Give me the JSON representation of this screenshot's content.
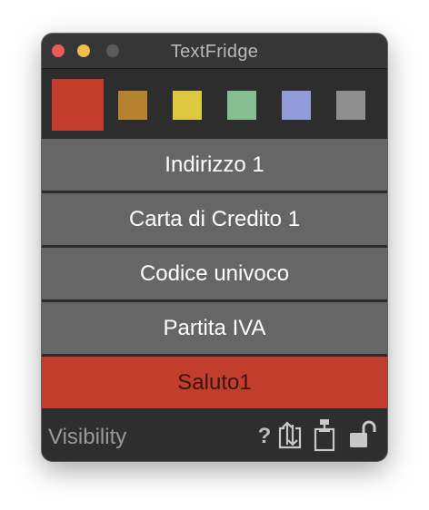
{
  "window": {
    "title": "TextFridge"
  },
  "palette": {
    "swatches": [
      {
        "name": "red",
        "color": "#c23d2b",
        "selected": true
      },
      {
        "name": "ochre",
        "color": "#b7822f",
        "selected": false
      },
      {
        "name": "yellow",
        "color": "#dcc940",
        "selected": false
      },
      {
        "name": "green",
        "color": "#88bd91",
        "selected": false
      },
      {
        "name": "lavender",
        "color": "#929ad8",
        "selected": false
      },
      {
        "name": "gray",
        "color": "#8f8f8f",
        "selected": false
      }
    ]
  },
  "snippets": [
    {
      "label": "Indirizzo 1",
      "selected": false
    },
    {
      "label": "Carta di Credito 1",
      "selected": false
    },
    {
      "label": "Codice univoco",
      "selected": false
    },
    {
      "label": "Partita IVA",
      "selected": false
    },
    {
      "label": "Saluto1",
      "selected": true
    }
  ],
  "footer": {
    "visibility_label": "Visibility",
    "help_label": "?",
    "icons": [
      "import-export-icon",
      "paste-icon",
      "unlock-icon"
    ]
  },
  "colors": {
    "accent": "#c23d2b",
    "row": "#666666",
    "background": "#2b2b2b"
  }
}
